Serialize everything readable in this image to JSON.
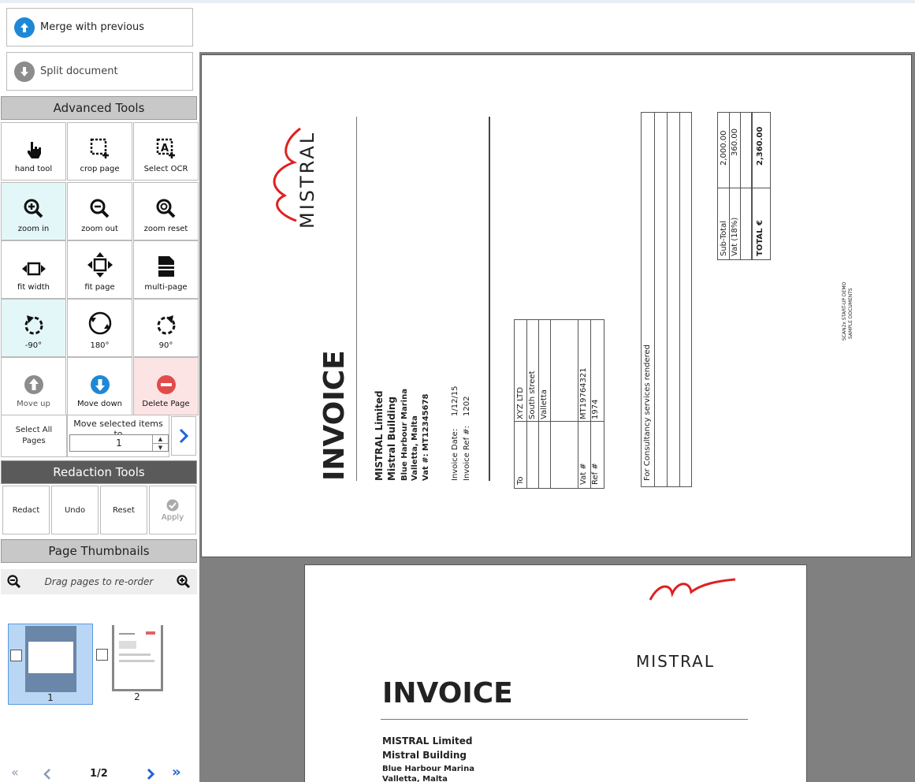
{
  "app": {
    "merge_label": "Merge with previous",
    "split_label": "Split document"
  },
  "advanced_tools": {
    "title": "Advanced Tools",
    "tools": [
      {
        "label": "hand tool",
        "icon": "hand-icon"
      },
      {
        "label": "crop page",
        "icon": "crop-icon"
      },
      {
        "label": "Select OCR",
        "icon": "ocr-select-icon"
      },
      {
        "label": "zoom in",
        "icon": "zoom-in-icon"
      },
      {
        "label": "zoom out",
        "icon": "zoom-out-icon"
      },
      {
        "label": "zoom reset",
        "icon": "zoom-reset-icon"
      },
      {
        "label": "fit width",
        "icon": "fit-width-icon"
      },
      {
        "label": "fit page",
        "icon": "fit-page-icon"
      },
      {
        "label": "multi-page",
        "icon": "multi-page-icon"
      },
      {
        "label": "-90°",
        "icon": "rotate-left-icon"
      },
      {
        "label": "180°",
        "icon": "rotate-180-icon"
      },
      {
        "label": "90°",
        "icon": "rotate-right-icon"
      },
      {
        "label": "Move up",
        "icon": "arrow-up-icon"
      },
      {
        "label": "Move down",
        "icon": "arrow-down-icon"
      },
      {
        "label": "Delete Page",
        "icon": "delete-icon"
      }
    ],
    "select_all_line1": "Select All",
    "select_all_line2": "Pages",
    "move_selected_label": "Move selected items to",
    "move_value": "1"
  },
  "redaction_tools": {
    "title": "Redaction Tools",
    "redact": "Redact",
    "undo": "Undo",
    "reset": "Reset",
    "apply": "Apply"
  },
  "thumbnails": {
    "title": "Page Thumbnails",
    "hint": "Drag pages to re-order",
    "pages": [
      {
        "label": "1",
        "selected": true
      },
      {
        "label": "2",
        "selected": false
      }
    ]
  },
  "pager": {
    "current": "1/2"
  },
  "document": {
    "logo_text": "MISTRAL",
    "title": "INVOICE",
    "company": "MISTRAL Limited",
    "building": "Mistral Building",
    "street": "Blue Harbour Marina",
    "city": "Valletta, Malta",
    "vat": "Vat #: MT12345678",
    "invoice_date_label": "Invoice Date:",
    "invoice_date": "1/12/15",
    "invoice_ref_label": "Invoice Ref #:",
    "invoice_ref": "1202",
    "to_label": "To",
    "to_name": "XYZ LTD",
    "to_street": "South street",
    "to_city": "Valletta",
    "vat_label": "Vat #",
    "vat_value": "MT19764321",
    "ref_label": "Ref #",
    "ref_value": "1974",
    "line_item": "For Consultancy services rendered",
    "subtotal_label": "Sub-Total",
    "subtotal_value": "2,000.00",
    "vat18_label": "Vat (18%)",
    "vat18_value": "360.00",
    "total_label": "TOTAL €",
    "total_value": "2,360.00",
    "watermark1": "SCAN2x START-UP DEMO",
    "watermark2": "SAMPLE DOCUMENTS"
  },
  "colors": {
    "blue": "#1e88d6",
    "gray": "#8c8c8c",
    "red": "#e24b4b",
    "cyan_bg": "#e4f7f8"
  }
}
